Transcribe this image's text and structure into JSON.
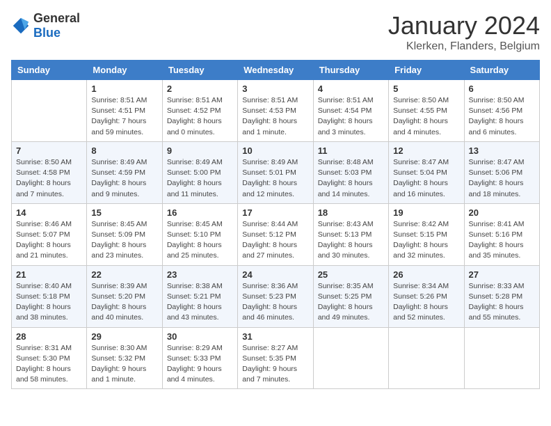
{
  "header": {
    "logo": {
      "general": "General",
      "blue": "Blue"
    },
    "title": "January 2024",
    "location": "Klerken, Flanders, Belgium"
  },
  "weekdays": [
    "Sunday",
    "Monday",
    "Tuesday",
    "Wednesday",
    "Thursday",
    "Friday",
    "Saturday"
  ],
  "weeks": [
    [
      {
        "day": "",
        "info": ""
      },
      {
        "day": "1",
        "info": "Sunrise: 8:51 AM\nSunset: 4:51 PM\nDaylight: 7 hours\nand 59 minutes."
      },
      {
        "day": "2",
        "info": "Sunrise: 8:51 AM\nSunset: 4:52 PM\nDaylight: 8 hours\nand 0 minutes."
      },
      {
        "day": "3",
        "info": "Sunrise: 8:51 AM\nSunset: 4:53 PM\nDaylight: 8 hours\nand 1 minute."
      },
      {
        "day": "4",
        "info": "Sunrise: 8:51 AM\nSunset: 4:54 PM\nDaylight: 8 hours\nand 3 minutes."
      },
      {
        "day": "5",
        "info": "Sunrise: 8:50 AM\nSunset: 4:55 PM\nDaylight: 8 hours\nand 4 minutes."
      },
      {
        "day": "6",
        "info": "Sunrise: 8:50 AM\nSunset: 4:56 PM\nDaylight: 8 hours\nand 6 minutes."
      }
    ],
    [
      {
        "day": "7",
        "info": "Sunrise: 8:50 AM\nSunset: 4:58 PM\nDaylight: 8 hours\nand 7 minutes."
      },
      {
        "day": "8",
        "info": "Sunrise: 8:49 AM\nSunset: 4:59 PM\nDaylight: 8 hours\nand 9 minutes."
      },
      {
        "day": "9",
        "info": "Sunrise: 8:49 AM\nSunset: 5:00 PM\nDaylight: 8 hours\nand 11 minutes."
      },
      {
        "day": "10",
        "info": "Sunrise: 8:49 AM\nSunset: 5:01 PM\nDaylight: 8 hours\nand 12 minutes."
      },
      {
        "day": "11",
        "info": "Sunrise: 8:48 AM\nSunset: 5:03 PM\nDaylight: 8 hours\nand 14 minutes."
      },
      {
        "day": "12",
        "info": "Sunrise: 8:47 AM\nSunset: 5:04 PM\nDaylight: 8 hours\nand 16 minutes."
      },
      {
        "day": "13",
        "info": "Sunrise: 8:47 AM\nSunset: 5:06 PM\nDaylight: 8 hours\nand 18 minutes."
      }
    ],
    [
      {
        "day": "14",
        "info": "Sunrise: 8:46 AM\nSunset: 5:07 PM\nDaylight: 8 hours\nand 21 minutes."
      },
      {
        "day": "15",
        "info": "Sunrise: 8:45 AM\nSunset: 5:09 PM\nDaylight: 8 hours\nand 23 minutes."
      },
      {
        "day": "16",
        "info": "Sunrise: 8:45 AM\nSunset: 5:10 PM\nDaylight: 8 hours\nand 25 minutes."
      },
      {
        "day": "17",
        "info": "Sunrise: 8:44 AM\nSunset: 5:12 PM\nDaylight: 8 hours\nand 27 minutes."
      },
      {
        "day": "18",
        "info": "Sunrise: 8:43 AM\nSunset: 5:13 PM\nDaylight: 8 hours\nand 30 minutes."
      },
      {
        "day": "19",
        "info": "Sunrise: 8:42 AM\nSunset: 5:15 PM\nDaylight: 8 hours\nand 32 minutes."
      },
      {
        "day": "20",
        "info": "Sunrise: 8:41 AM\nSunset: 5:16 PM\nDaylight: 8 hours\nand 35 minutes."
      }
    ],
    [
      {
        "day": "21",
        "info": "Sunrise: 8:40 AM\nSunset: 5:18 PM\nDaylight: 8 hours\nand 38 minutes."
      },
      {
        "day": "22",
        "info": "Sunrise: 8:39 AM\nSunset: 5:20 PM\nDaylight: 8 hours\nand 40 minutes."
      },
      {
        "day": "23",
        "info": "Sunrise: 8:38 AM\nSunset: 5:21 PM\nDaylight: 8 hours\nand 43 minutes."
      },
      {
        "day": "24",
        "info": "Sunrise: 8:36 AM\nSunset: 5:23 PM\nDaylight: 8 hours\nand 46 minutes."
      },
      {
        "day": "25",
        "info": "Sunrise: 8:35 AM\nSunset: 5:25 PM\nDaylight: 8 hours\nand 49 minutes."
      },
      {
        "day": "26",
        "info": "Sunrise: 8:34 AM\nSunset: 5:26 PM\nDaylight: 8 hours\nand 52 minutes."
      },
      {
        "day": "27",
        "info": "Sunrise: 8:33 AM\nSunset: 5:28 PM\nDaylight: 8 hours\nand 55 minutes."
      }
    ],
    [
      {
        "day": "28",
        "info": "Sunrise: 8:31 AM\nSunset: 5:30 PM\nDaylight: 8 hours\nand 58 minutes."
      },
      {
        "day": "29",
        "info": "Sunrise: 8:30 AM\nSunset: 5:32 PM\nDaylight: 9 hours\nand 1 minute."
      },
      {
        "day": "30",
        "info": "Sunrise: 8:29 AM\nSunset: 5:33 PM\nDaylight: 9 hours\nand 4 minutes."
      },
      {
        "day": "31",
        "info": "Sunrise: 8:27 AM\nSunset: 5:35 PM\nDaylight: 9 hours\nand 7 minutes."
      },
      {
        "day": "",
        "info": ""
      },
      {
        "day": "",
        "info": ""
      },
      {
        "day": "",
        "info": ""
      }
    ]
  ]
}
